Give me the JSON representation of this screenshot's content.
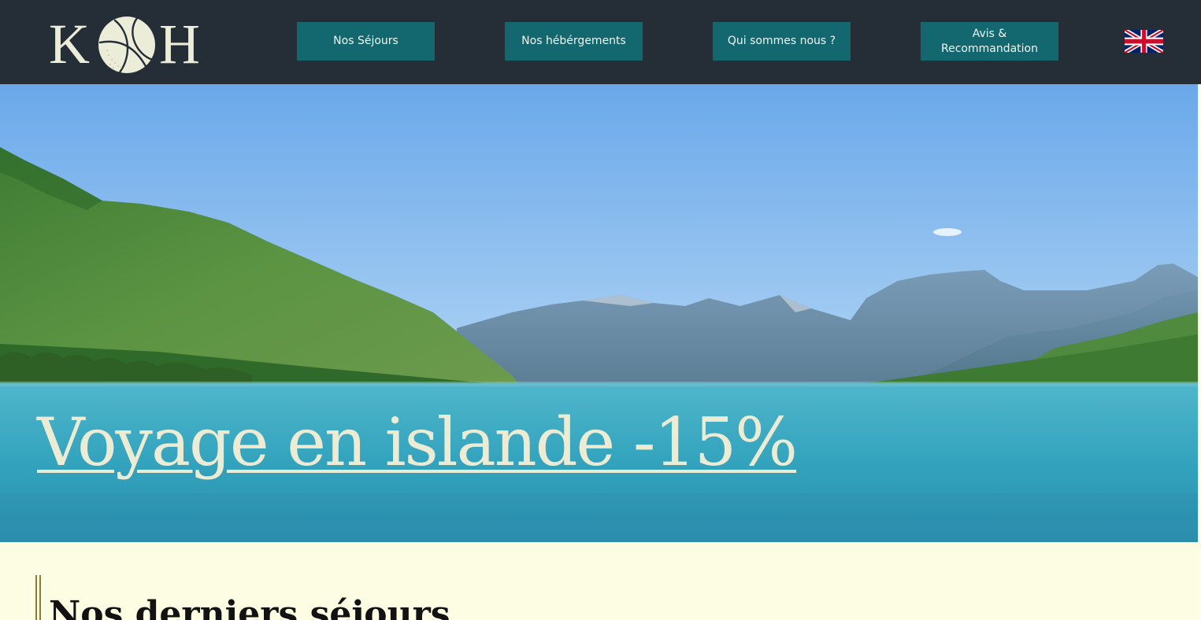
{
  "header": {
    "logo": {
      "letters": [
        "K",
        "H"
      ],
      "icon": "basketball-icon"
    },
    "nav": [
      {
        "label": "Nos Séjours"
      },
      {
        "label": "Nos hébérgements"
      },
      {
        "label": "Qui sommes nous ?"
      },
      {
        "label": "Avis & Recommandation"
      }
    ],
    "language": {
      "icon": "uk-flag-icon"
    }
  },
  "hero": {
    "title": "Voyage en islande -15%"
  },
  "section": {
    "title": "Nos derniers séjours"
  },
  "colors": {
    "header_bg": "#252d36",
    "nav_button_bg": "#136870",
    "logo": "#ecedd9",
    "page_bg": "#fefee6",
    "section_accent": "#8c7f33"
  }
}
